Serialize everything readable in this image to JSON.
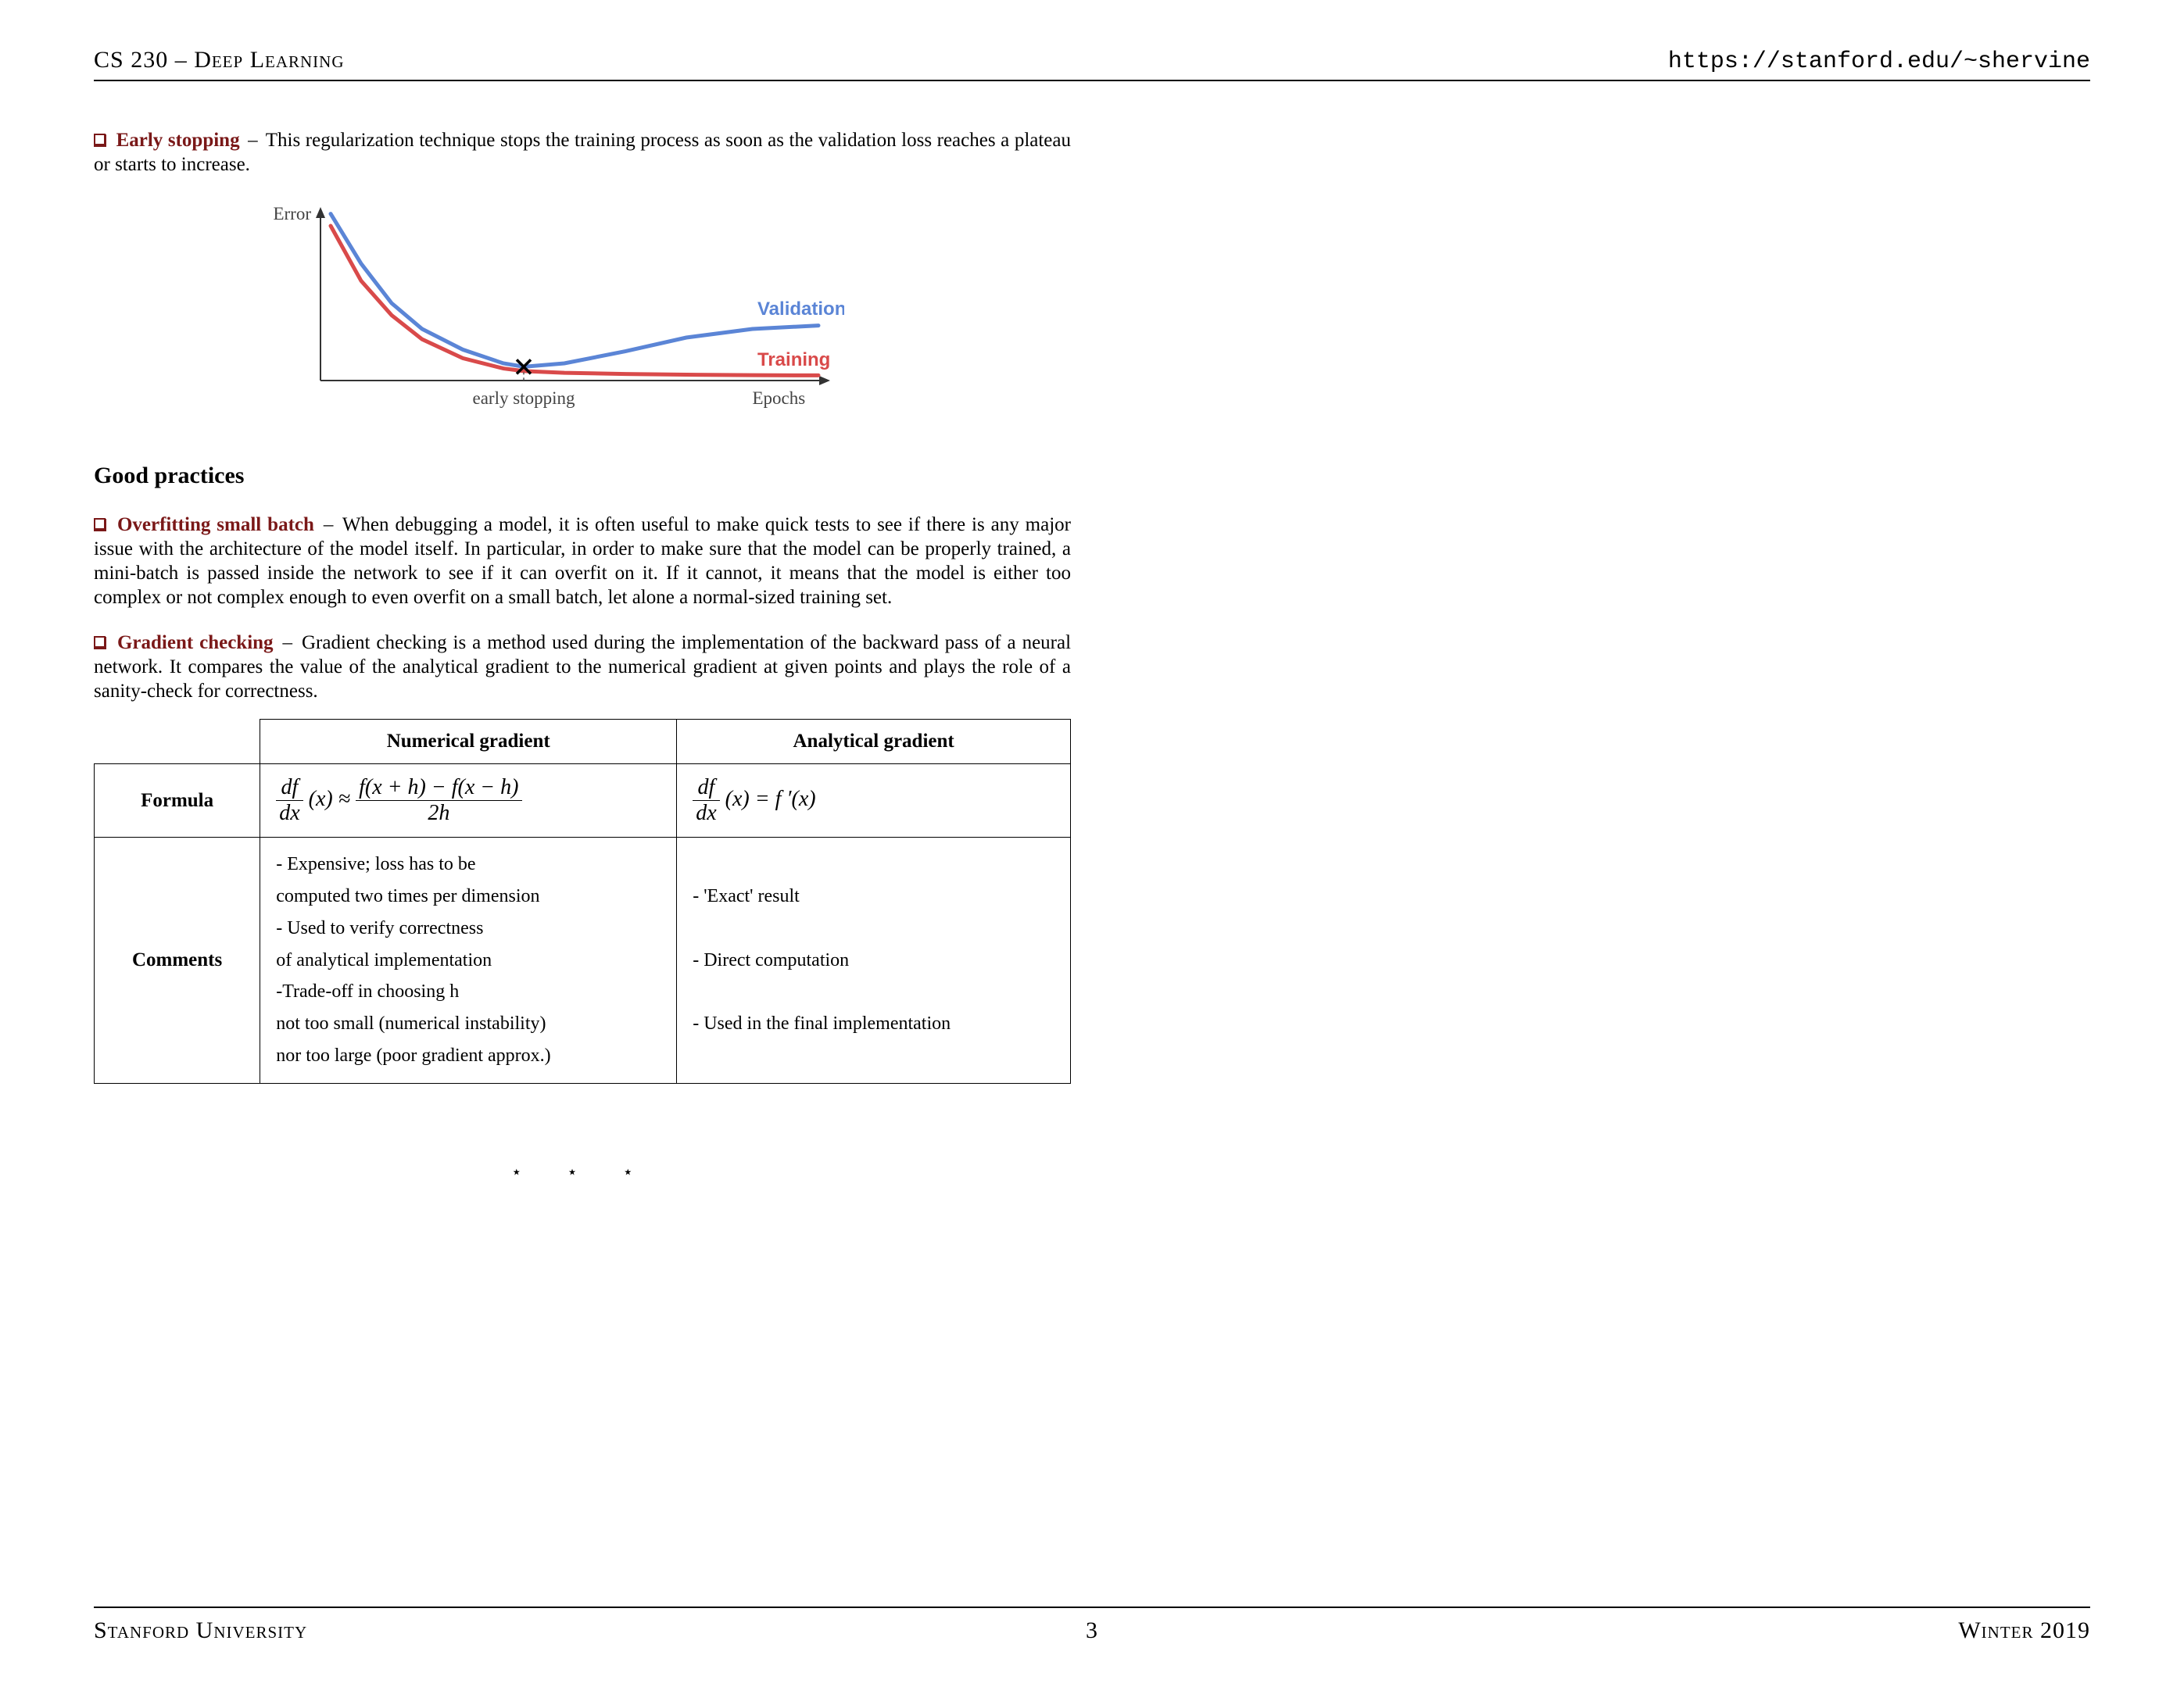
{
  "header": {
    "left": "CS 230 – Deep Learning",
    "right": "https://stanford.edu/~shervine"
  },
  "early_stopping": {
    "term": "Early stopping",
    "body": "This regularization technique stops the training process as soon as the validation loss reaches a plateau or starts to increase."
  },
  "chart_data": {
    "type": "line",
    "xlabel": "Epochs",
    "ylabel": "Error",
    "annotations": {
      "marker_label": "early stopping",
      "marker_x": 0.4
    },
    "x": [
      0.02,
      0.08,
      0.14,
      0.2,
      0.28,
      0.36,
      0.4,
      0.48,
      0.6,
      0.72,
      0.85,
      0.98
    ],
    "series": [
      {
        "name": "Validation",
        "color": "#5b85d6",
        "values": [
          0.97,
          0.68,
          0.45,
          0.3,
          0.18,
          0.1,
          0.08,
          0.1,
          0.17,
          0.25,
          0.3,
          0.32
        ]
      },
      {
        "name": "Training",
        "color": "#d94a4a",
        "values": [
          0.9,
          0.58,
          0.38,
          0.24,
          0.13,
          0.07,
          0.055,
          0.045,
          0.038,
          0.034,
          0.031,
          0.03
        ]
      }
    ]
  },
  "good_practices_heading": "Good practices",
  "overfit": {
    "term": "Overfitting small batch",
    "body": "When debugging a model, it is often useful to make quick tests to see if there is any major issue with the architecture of the model itself. In particular, in order to make sure that the model can be properly trained, a mini-batch is passed inside the network to see if it can overfit on it. If it cannot, it means that the model is either too complex or not complex enough to even overfit on a small batch, let alone a normal-sized training set."
  },
  "gradient_checking": {
    "term": "Gradient checking",
    "body": "Gradient checking is a method used during the implementation of the backward pass of a neural network. It compares the value of the analytical gradient to the numerical gradient at given points and plays the role of a sanity-check for correctness."
  },
  "table": {
    "col1": "Numerical gradient",
    "col2": "Analytical gradient",
    "row_formula_label": "Formula",
    "row_comments_label": "Comments",
    "formula_num_lhs_num": "df",
    "formula_num_lhs_den": "dx",
    "formula_num_lhs_arg": "(x) ≈",
    "formula_num_rhs_num": "f(x + h) − f(x − h)",
    "formula_num_rhs_den": "2h",
    "formula_ana_lhs_num": "df",
    "formula_ana_lhs_den": "dx",
    "formula_ana_rhs": "(x) = f ′(x)",
    "comments_num": "- Expensive; loss has to be\ncomputed two times per dimension\n- Used to verify correctness\nof analytical implementation\n-Trade-off in choosing h\nnot too small (numerical instability)\nnor too large (poor gradient approx.)",
    "comments_ana": "- 'Exact' result\n\n- Direct computation\n\n- Used in the final implementation"
  },
  "stars": "⋆ ⋆ ⋆",
  "footer": {
    "left": "Stanford University",
    "page": "3",
    "right": "Winter 2019"
  }
}
